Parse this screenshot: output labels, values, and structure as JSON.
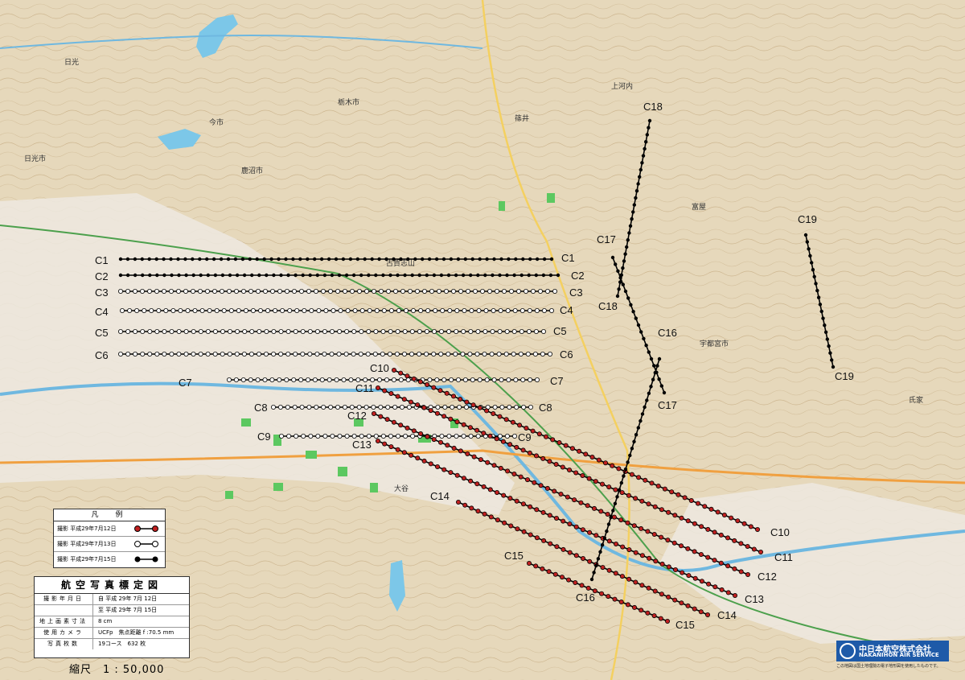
{
  "legend": {
    "title": "凡　例",
    "rows": [
      {
        "label": "撮影 平成29年7月12日",
        "color": "#c02020"
      },
      {
        "label": "撮影 平成29年7月13日",
        "color": "#ffffff"
      },
      {
        "label": "撮影 平成29年7月15日",
        "color": "#000000"
      }
    ]
  },
  "info": {
    "title": "航空写真標定図",
    "rows": [
      {
        "key": "撮影年月日",
        "value": "自 平成 29年 7月 12日"
      },
      {
        "key": "",
        "value": "至 平成 29年 7月 15日"
      },
      {
        "key": "地上画素寸法",
        "value": "8 cm"
      },
      {
        "key": "使用カメラ",
        "value": "UCFp　焦点距離 f :70.5 mm"
      },
      {
        "key": "写真枚数",
        "value": "19コース　632 枚"
      }
    ]
  },
  "scale": "縮尺　1 : 50,000",
  "company": {
    "name_ja": "中日本航空株式会社",
    "name_en": "NAKANIHON AIR SERVICE",
    "note": "この地図は国土地理院の電子地形図を使用したものです。"
  },
  "place_names": [
    "日光市",
    "鹿沼市",
    "栃木市",
    "宇都宮市",
    "日光",
    "今市",
    "大谷",
    "古賀志山",
    "篠井",
    "富屋",
    "上河内",
    "氏家"
  ],
  "courses": [
    {
      "name": "C1",
      "color": "#000000",
      "start_label": "C1",
      "end_label": "C1"
    },
    {
      "name": "C2",
      "color": "#000000",
      "start_label": "C2",
      "end_label": "C2"
    },
    {
      "name": "C3",
      "color": "#ffffff",
      "start_label": "C3",
      "end_label": "C3"
    },
    {
      "name": "C4",
      "color": "#ffffff",
      "start_label": "C4",
      "end_label": "C4"
    },
    {
      "name": "C5",
      "color": "#ffffff",
      "start_label": "C5",
      "end_label": "C5"
    },
    {
      "name": "C6",
      "color": "#ffffff",
      "start_label": "C6",
      "end_label": "C6"
    },
    {
      "name": "C7",
      "color": "#ffffff",
      "start_label": "C7",
      "end_label": "C7"
    },
    {
      "name": "C8",
      "color": "#ffffff",
      "start_label": "C8",
      "end_label": "C8"
    },
    {
      "name": "C9",
      "color": "#ffffff",
      "start_label": "C9",
      "end_label": "C9"
    },
    {
      "name": "C10",
      "color": "#c02020",
      "start_label": "C10",
      "end_label": "C10"
    },
    {
      "name": "C11",
      "color": "#c02020",
      "start_label": "C11",
      "end_label": "C11"
    },
    {
      "name": "C12",
      "color": "#c02020",
      "start_label": "C12",
      "end_label": "C12"
    },
    {
      "name": "C13",
      "color": "#c02020",
      "start_label": "C13",
      "end_label": "C13"
    },
    {
      "name": "C14",
      "color": "#c02020",
      "start_label": "C14",
      "end_label": "C14"
    },
    {
      "name": "C15",
      "color": "#c02020",
      "start_label": "C15",
      "end_label": "C15"
    },
    {
      "name": "C16",
      "color": "#000000",
      "start_label": "C16",
      "end_label": "C16"
    },
    {
      "name": "C17",
      "color": "#000000",
      "start_label": "C17",
      "end_label": "C17"
    },
    {
      "name": "C18",
      "color": "#000000",
      "start_label": "C18",
      "end_label": "C18"
    },
    {
      "name": "C19",
      "color": "#000000",
      "start_label": "C19",
      "end_label": "C19"
    }
  ]
}
